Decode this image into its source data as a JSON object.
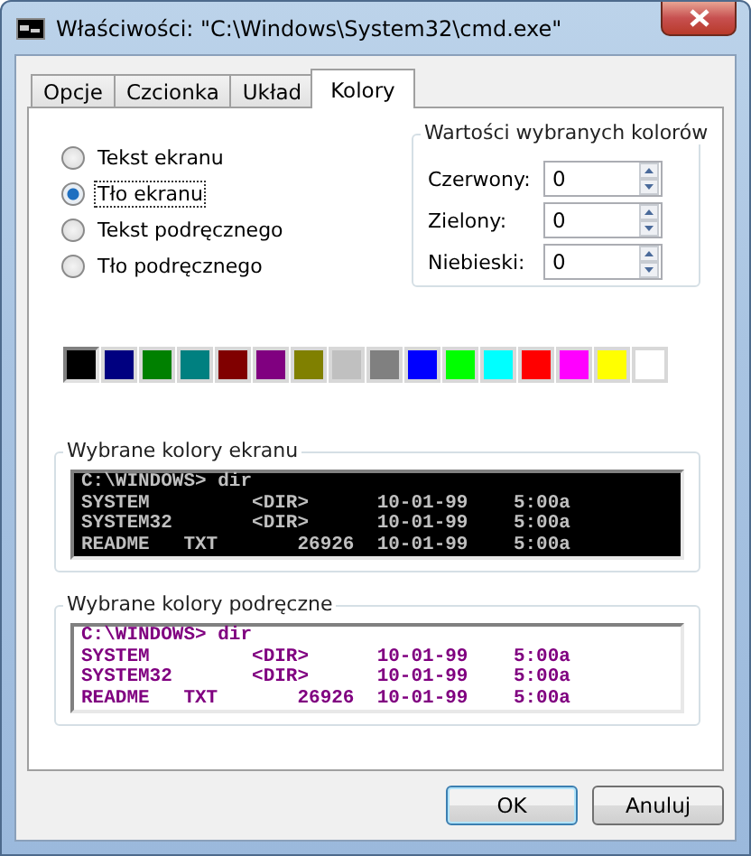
{
  "window": {
    "title": "Właściwości: \"C:\\Windows\\System32\\cmd.exe\""
  },
  "tabs": [
    {
      "label": "Opcje",
      "selected": false
    },
    {
      "label": "Czcionka",
      "selected": false
    },
    {
      "label": "Układ",
      "selected": false
    },
    {
      "label": "Kolory",
      "selected": true
    }
  ],
  "color_targets": [
    {
      "label": "Tekst ekranu",
      "selected": false
    },
    {
      "label": "Tło ekranu",
      "selected": true
    },
    {
      "label": "Tekst podręcznego",
      "selected": false
    },
    {
      "label": "Tło podręcznego",
      "selected": false
    }
  ],
  "color_values": {
    "title": "Wartości wybranych kolorów",
    "fields": [
      {
        "label": "Czerwony:",
        "value": "0"
      },
      {
        "label": "Zielony:",
        "value": "0"
      },
      {
        "label": "Niebieski:",
        "value": "0"
      }
    ]
  },
  "palette": [
    {
      "color": "#000000",
      "selected": true
    },
    {
      "color": "#000080",
      "selected": false
    },
    {
      "color": "#008000",
      "selected": false
    },
    {
      "color": "#008080",
      "selected": false
    },
    {
      "color": "#800000",
      "selected": false
    },
    {
      "color": "#800080",
      "selected": false
    },
    {
      "color": "#808000",
      "selected": false
    },
    {
      "color": "#c0c0c0",
      "selected": false
    },
    {
      "color": "#808080",
      "selected": false
    },
    {
      "color": "#0000ff",
      "selected": false
    },
    {
      "color": "#00ff00",
      "selected": false
    },
    {
      "color": "#00ffff",
      "selected": false
    },
    {
      "color": "#ff0000",
      "selected": false
    },
    {
      "color": "#ff00ff",
      "selected": false
    },
    {
      "color": "#ffff00",
      "selected": false
    },
    {
      "color": "#ffffff",
      "selected": false
    }
  ],
  "previews": [
    {
      "title": "Wybrane kolory ekranu",
      "color": "#c0c0c0",
      "background": {
        "color": "#000000"
      },
      "lines": [
        "C:\\WINDOWS> dir",
        "SYSTEM         <DIR>      10-01-99    5:00a",
        "SYSTEM32       <DIR>      10-01-99    5:00a",
        "README   TXT       26926  10-01-99    5:00a"
      ]
    },
    {
      "title": "Wybrane kolory podręczne",
      "color": "#800080",
      "background": {
        "color": "#ffffff"
      },
      "lines": [
        "C:\\WINDOWS> dir",
        "SYSTEM         <DIR>      10-01-99    5:00a",
        "SYSTEM32       <DIR>      10-01-99    5:00a",
        "README   TXT       26926  10-01-99    5:00a"
      ]
    }
  ],
  "buttons": [
    {
      "label": "OK",
      "default": true
    },
    {
      "label": "Anuluj",
      "default": false
    }
  ]
}
